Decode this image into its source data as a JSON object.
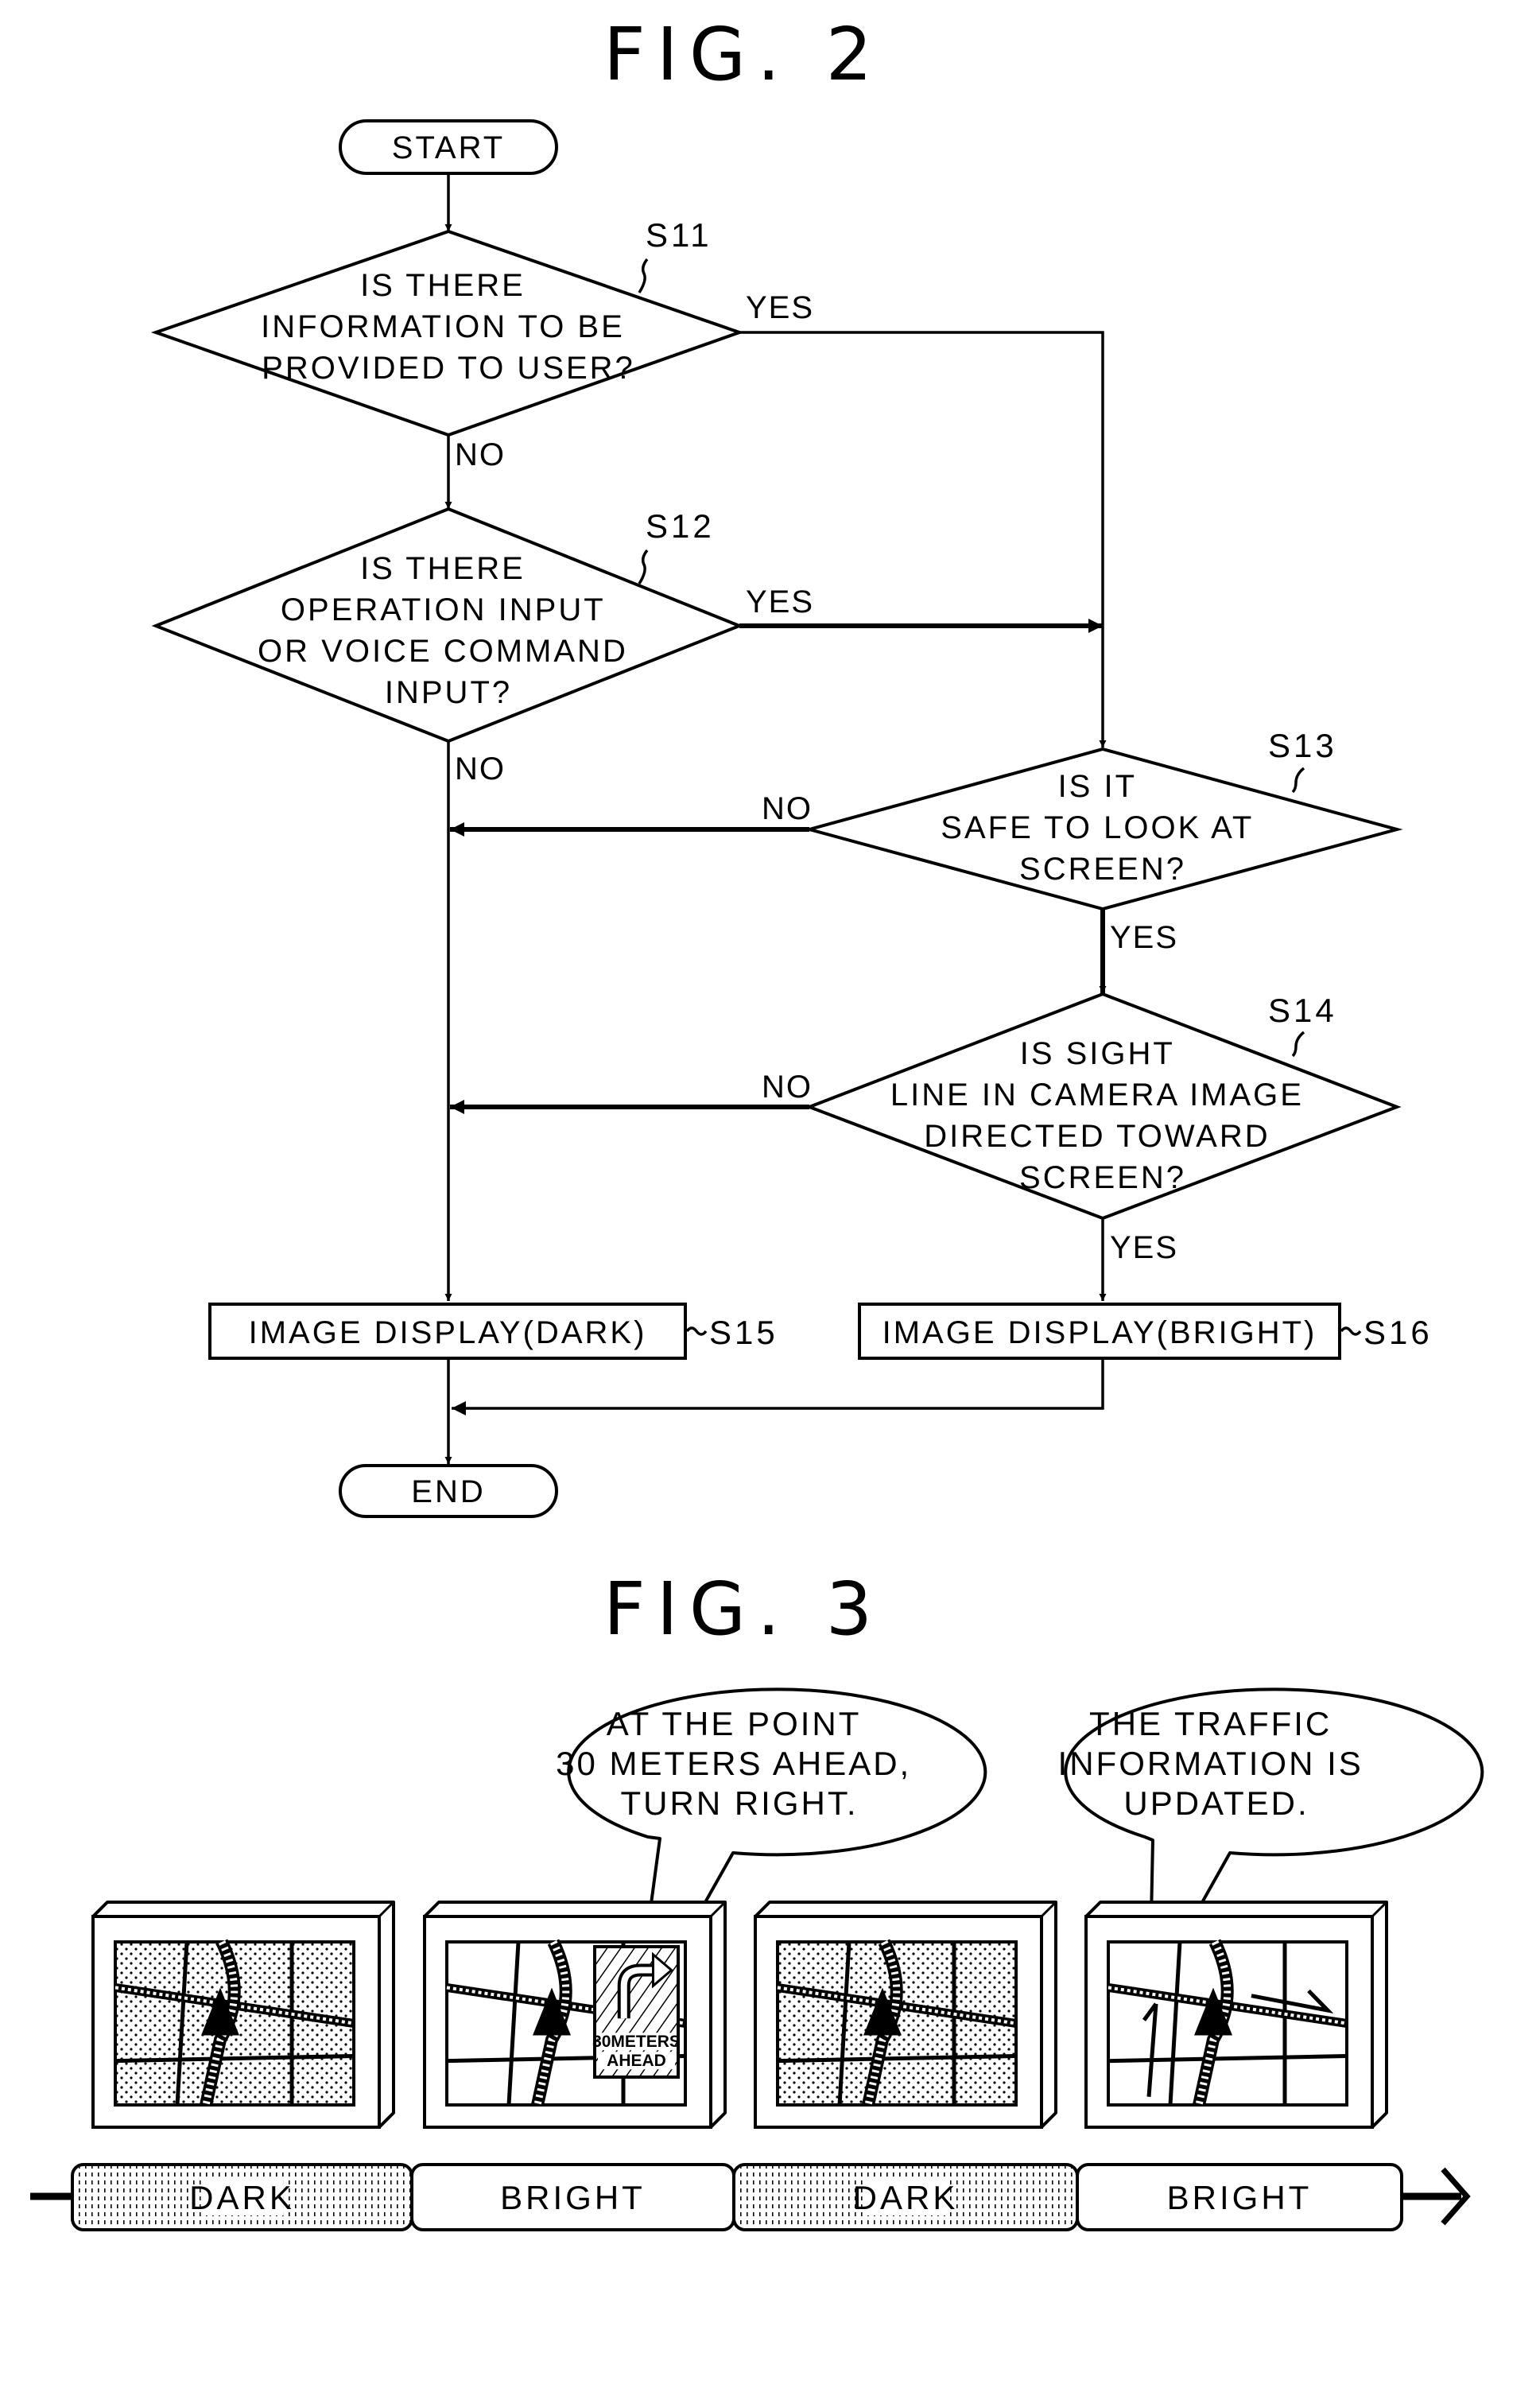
{
  "fig2": {
    "title": "FIG. 2",
    "start": "START",
    "end": "END",
    "steps": {
      "s11": {
        "id": "S11",
        "lines": [
          "IS THERE",
          "INFORMATION TO BE",
          "PROVIDED TO USER?"
        ],
        "yes": "YES",
        "no": "NO"
      },
      "s12": {
        "id": "S12",
        "lines": [
          "IS THERE",
          "OPERATION INPUT",
          "OR VOICE COMMAND",
          "INPUT?"
        ],
        "yes": "YES",
        "no": "NO"
      },
      "s13": {
        "id": "S13",
        "lines": [
          "IS IT",
          "SAFE TO LOOK AT",
          "SCREEN?"
        ],
        "yes": "YES",
        "no": "NO"
      },
      "s14": {
        "id": "S14",
        "lines": [
          "IS SIGHT",
          "LINE IN CAMERA IMAGE",
          "DIRECTED TOWARD",
          "SCREEN?"
        ],
        "yes": "YES",
        "no": "NO"
      },
      "s15": {
        "id": "S15",
        "label": "IMAGE DISPLAY(DARK)"
      },
      "s16": {
        "id": "S16",
        "label": "IMAGE DISPLAY(BRIGHT)"
      }
    }
  },
  "fig3": {
    "title": "FIG. 3",
    "bubbles": [
      {
        "lines": [
          "AT THE POINT",
          "30 METERS AHEAD,",
          "TURN RIGHT."
        ]
      },
      {
        "lines": [
          "THE TRAFFIC",
          "INFORMATION IS",
          "UPDATED."
        ]
      }
    ],
    "screens": [
      {
        "state": "dark"
      },
      {
        "state": "bright",
        "sign_lines": [
          "30METERS",
          "AHEAD"
        ]
      },
      {
        "state": "dark"
      },
      {
        "state": "bright"
      }
    ],
    "timeline": [
      {
        "label": "DARK",
        "state": "dark"
      },
      {
        "label": "BRIGHT",
        "state": "bright"
      },
      {
        "label": "DARK",
        "state": "dark"
      },
      {
        "label": "BRIGHT",
        "state": "bright"
      }
    ]
  }
}
